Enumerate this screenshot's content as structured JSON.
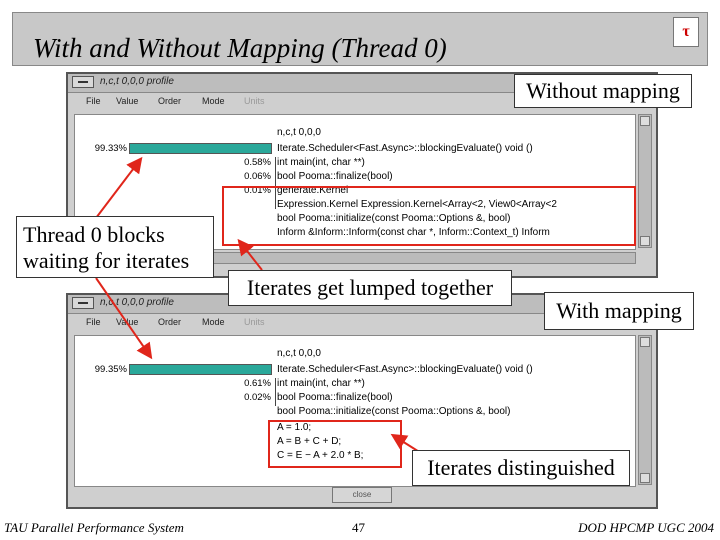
{
  "slide": {
    "title": "With and Without Mapping (Thread 0)",
    "footer_left": "TAU Parallel Performance System",
    "page_number": "47",
    "footer_right": "DOD HPCMP UGC 2004"
  },
  "window_top": {
    "title": "n,c,t 0,0,0 profile",
    "menu": [
      "File",
      "Value",
      "Order",
      "Mode",
      "Units"
    ],
    "header": "n,c,t 0,0,0",
    "rows": [
      {
        "pct": "99.33%",
        "label": "Iterate.Scheduler<Fast.Async>::blockingEvaluate() void ()",
        "bar": 0.9933
      },
      {
        "pct": "0.58%",
        "label": "int main(int, char **)"
      },
      {
        "pct": "0.06%",
        "label": "bool Pooma::finalize(bool)"
      },
      {
        "pct": "0.01%",
        "label": "generate.Kernel"
      },
      {
        "pct": "",
        "label": "Expression.Kernel Expression.Kernel<Array<2, View0<Array<2"
      },
      {
        "pct": "",
        "label": "bool Pooma::initialize(const Pooma::Options &, bool)"
      },
      {
        "pct": "",
        "label": "Inform &Inform::Inform(const char *, Inform::Context_t) Inform"
      }
    ]
  },
  "window_bottom": {
    "title": "n,c,t 0,0,0 profile",
    "menu": [
      "File",
      "Value",
      "Order",
      "Mode",
      "Units"
    ],
    "header": "n,c,t 0,0,0",
    "rows": [
      {
        "pct": "99.35%",
        "label": "Iterate.Scheduler<Fast.Async>::blockingEvaluate() void ()",
        "bar": 0.9935
      },
      {
        "pct": "0.61%",
        "label": "int main(int, char **)"
      },
      {
        "pct": "0.02%",
        "label": "bool Pooma::finalize(bool)"
      },
      {
        "pct": "",
        "label": "bool Pooma::initialize(const Pooma::Options &, bool)"
      },
      {
        "pct": "",
        "label": "A = 1.0;"
      },
      {
        "pct": "",
        "label": "A = B + C + D;"
      },
      {
        "pct": "",
        "label": "C = E − A + 2.0 * B;"
      }
    ],
    "close_label": "close"
  },
  "callouts": {
    "without_mapping": "Without mapping",
    "thread_blocks_line1": "Thread 0 blocks",
    "thread_blocks_line2": "waiting for iterates",
    "lumped": "Iterates get lumped together",
    "with_mapping": "With mapping",
    "distinguished": "Iterates distinguished"
  },
  "colors": {
    "bar": "#2aa89a",
    "highlight": "#e0261b",
    "title_bg": "#c8c8c8"
  }
}
